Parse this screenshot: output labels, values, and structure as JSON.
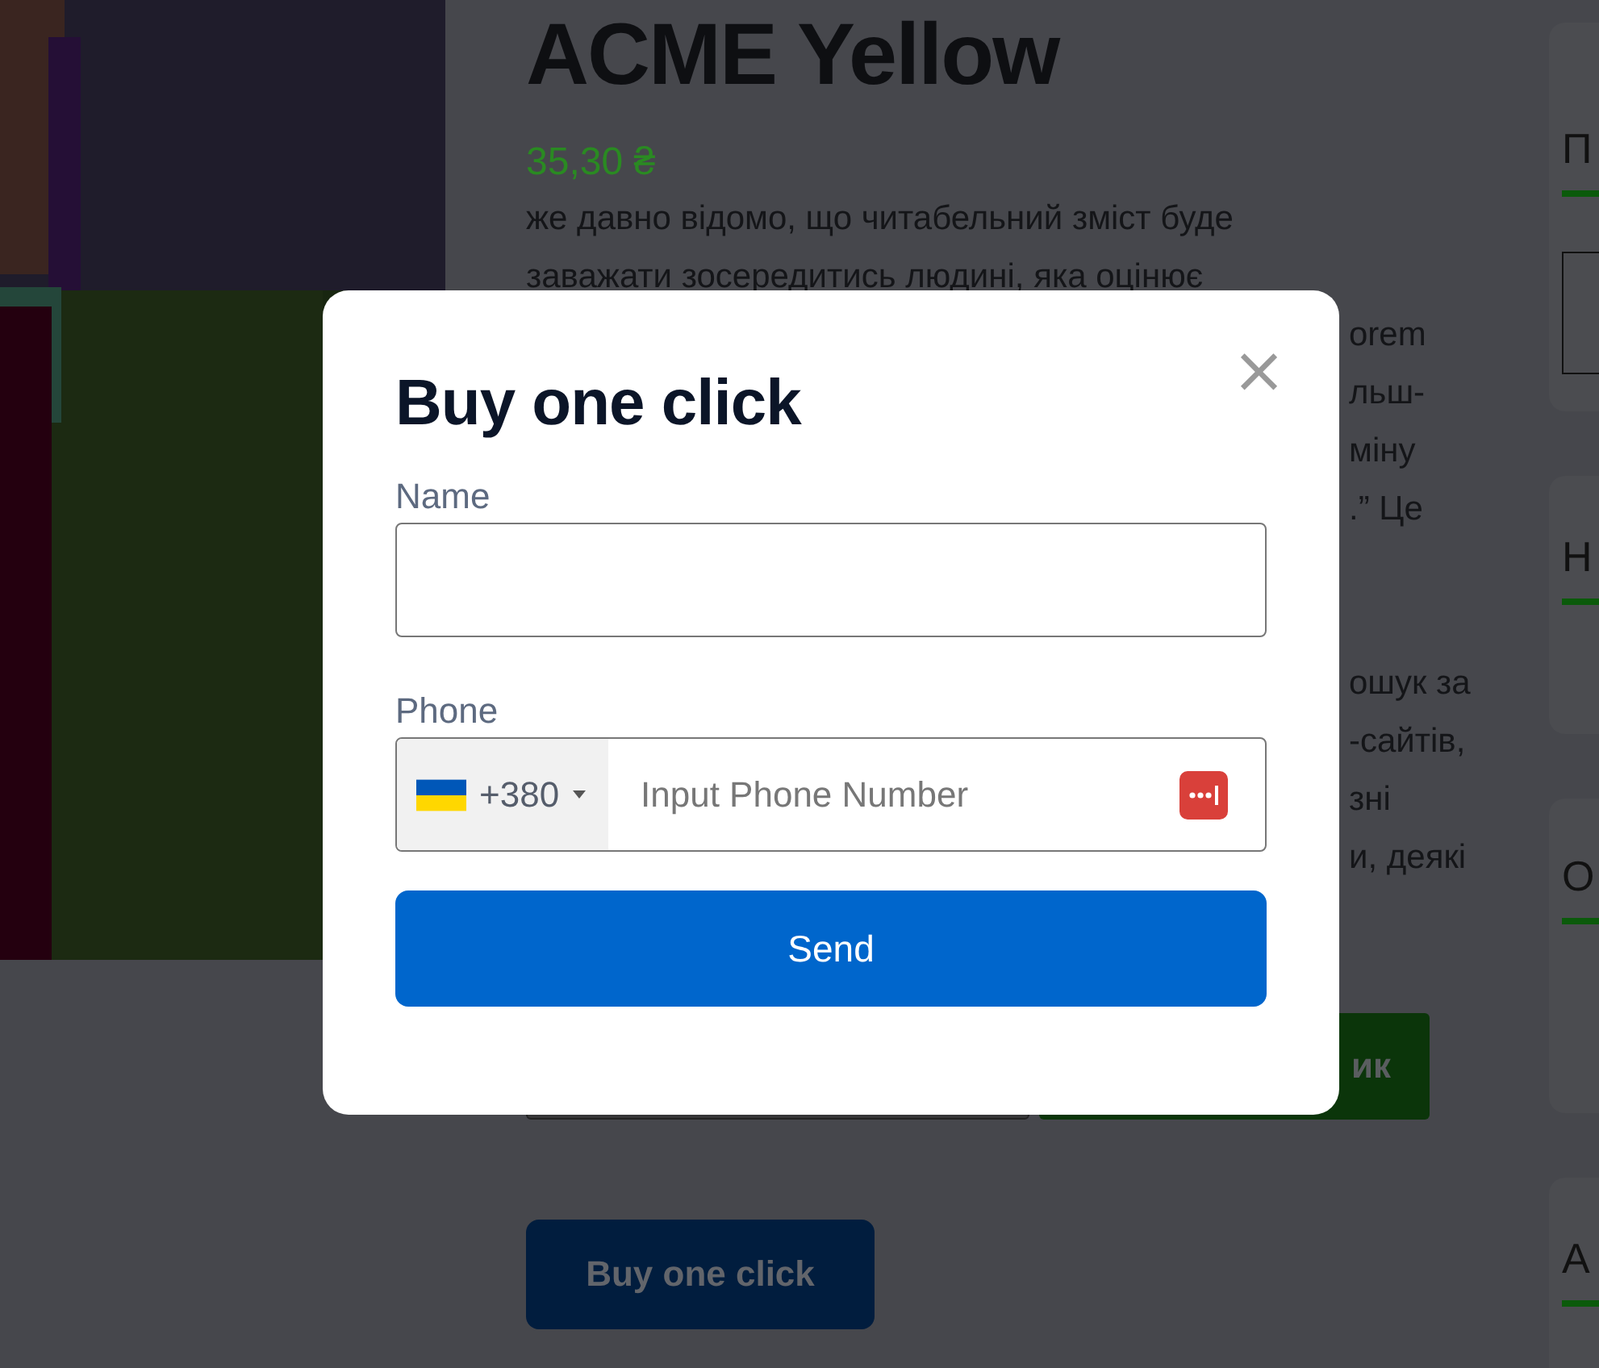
{
  "product": {
    "title": "ACME Yellow",
    "price": "35,30 ₴",
    "description_lines": [
      "же давно відомо, що читабельний зміст буде",
      "заважати зосередитись людині, яка оцінює"
    ],
    "description_fragments": [
      [
        "orem",
        "льш-",
        "міну",
        ".” Це"
      ],
      [
        "ошук за",
        "-сайтів,",
        "зні",
        "и, деякі"
      ]
    ],
    "add_to_cart_label": "ик",
    "buy_one_click_label": "Buy one click"
  },
  "sidebar": {
    "cards": [
      {
        "heading": "П",
        "has_field": true
      },
      {
        "heading": "Н",
        "has_field": false
      },
      {
        "heading": "О",
        "has_field": false
      },
      {
        "heading": "А",
        "has_field": false
      }
    ]
  },
  "modal": {
    "title": "Buy one click",
    "close": "×",
    "name_field": {
      "label": "Name"
    },
    "phone_field": {
      "label": "Phone",
      "country_code": "+380",
      "placeholder": "Input Phone Number"
    },
    "submit": "Send"
  }
}
